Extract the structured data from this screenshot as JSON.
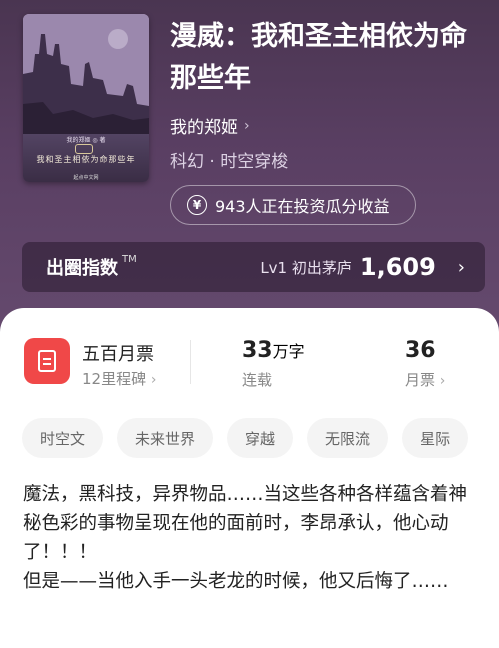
{
  "book": {
    "title": "漫威：我和圣主相依为命那些年",
    "author": "我的郑姬",
    "genre": "科幻 · 时空穿梭",
    "cover": {
      "author_line": "我的郑姬 ◎ 著",
      "title_line": "我和圣主相依为命那些年",
      "publisher": "起点中文网"
    }
  },
  "invest": {
    "text": "943人正在投资瓜分收益",
    "icon": "yen-icon"
  },
  "index": {
    "label": "出圈指数",
    "tm": "TM",
    "level": "Lv1 初出茅庐",
    "value": "1,609"
  },
  "stats": {
    "rank_title": "五百月票",
    "rank_sub": "12里程碑",
    "words_num": "33",
    "words_unit": "万字",
    "words_label": "连载",
    "tickets_num": "36",
    "tickets_label": "月票"
  },
  "tags": [
    "时空文",
    "未来世界",
    "穿越",
    "无限流",
    "星际"
  ],
  "description": "魔法，黑科技，异界物品……当这些各种各样蕴含着神秘色彩的事物呈现在他的面前时，李昂承认，他心动了！！！\n但是——当他入手一头老龙的时候，他又后悔了……",
  "colors": {
    "hero": "#5a3f63",
    "accent": "#f04848"
  }
}
